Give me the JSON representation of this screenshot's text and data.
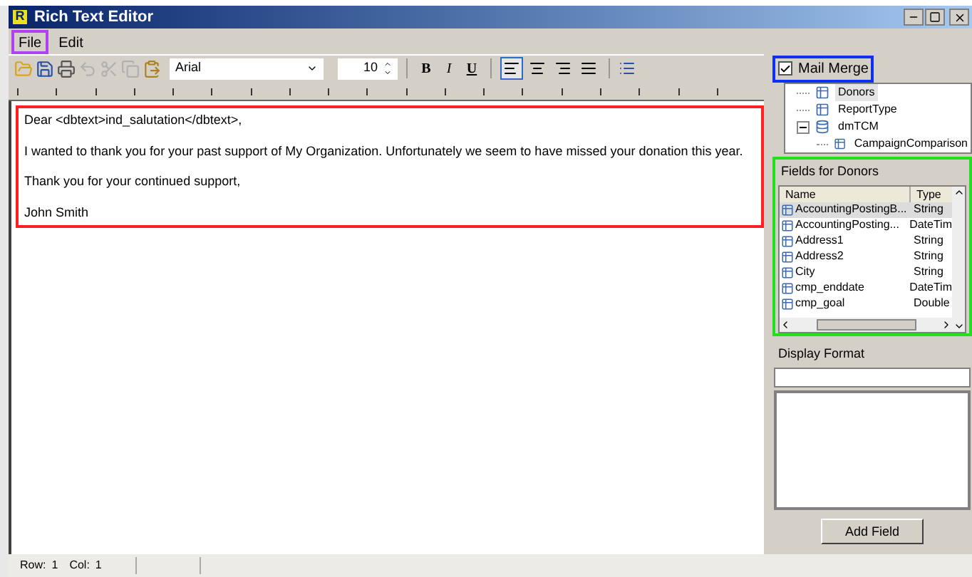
{
  "window": {
    "title": "Rich Text Editor",
    "logo": "R"
  },
  "menu": [
    {
      "label": "File",
      "highlighted": true
    },
    {
      "label": "Edit",
      "highlighted": false
    }
  ],
  "toolbar": {
    "left": [
      {
        "kind": "open",
        "disabled": false
      },
      {
        "kind": "save",
        "disabled": false
      },
      {
        "kind": "print",
        "disabled": false
      },
      {
        "kind": "undo",
        "disabled": true
      },
      {
        "kind": "cut",
        "disabled": true
      },
      {
        "kind": "copy",
        "disabled": true
      },
      {
        "kind": "paste",
        "disabled": false
      }
    ],
    "font": "Arial",
    "size": "10",
    "styles": [
      {
        "label": "B",
        "kind": "bold"
      },
      {
        "label": "I",
        "kind": "italic"
      },
      {
        "label": "U",
        "kind": "underline"
      }
    ],
    "align": [
      {
        "kind": "left",
        "selected": true
      },
      {
        "kind": "center",
        "selected": false
      },
      {
        "kind": "right",
        "selected": false
      },
      {
        "kind": "justify",
        "selected": false
      }
    ]
  },
  "editor": {
    "paragraphs": [
      "Dear <dbtext>ind_salutation</dbtext>,",
      "I wanted to thank you for your past support of My Organization. Unfortunately we seem to have missed your donation this year.",
      "Thank you for your continued support,",
      "John Smith"
    ]
  },
  "mail_merge": {
    "label": "Mail Merge",
    "checked": true
  },
  "tree": [
    {
      "label": "Donors",
      "kind": "table",
      "selected": true
    },
    {
      "label": "ReportType",
      "kind": "table",
      "selected": false
    },
    {
      "label": "dmTCM",
      "kind": "database",
      "selected": false,
      "expanded": true,
      "children": [
        {
          "label": "CampaignComparison",
          "kind": "table",
          "selected": false
        }
      ]
    }
  ],
  "fields": {
    "title": "Fields for Donors",
    "columns": [
      "Name",
      "Type"
    ],
    "rows": [
      {
        "name": "AccountingPostingB...",
        "type": "String",
        "selected": true
      },
      {
        "name": "AccountingPosting...",
        "type": "DateTim",
        "selected": false
      },
      {
        "name": "Address1",
        "type": "String",
        "selected": false
      },
      {
        "name": "Address2",
        "type": "String",
        "selected": false
      },
      {
        "name": "City",
        "type": "String",
        "selected": false
      },
      {
        "name": "cmp_enddate",
        "type": "DateTim",
        "selected": false
      },
      {
        "name": "cmp_goal",
        "type": "Double",
        "selected": false
      }
    ]
  },
  "display_format": {
    "label": "Display Format"
  },
  "add_field_button": "Add Field",
  "status_bar": {
    "row_label": "Row:",
    "row": "1",
    "col_label": "Col:",
    "col": "1"
  }
}
